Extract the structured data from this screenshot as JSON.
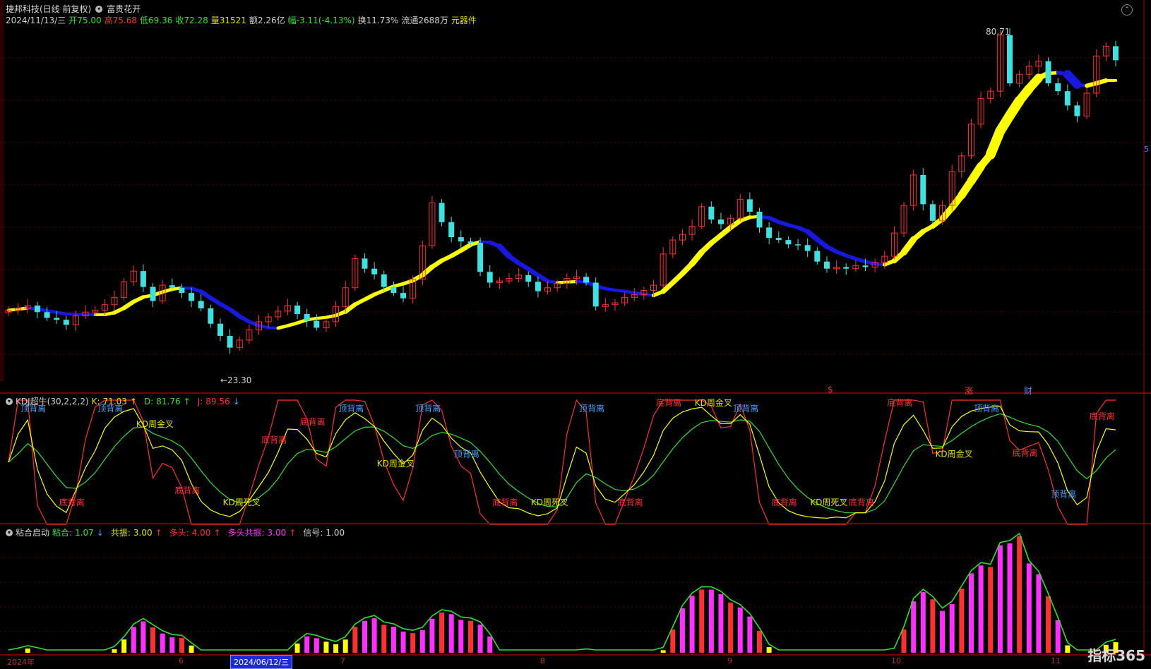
{
  "header": {
    "stock_name": "捷邦科技(日线 前复权)",
    "indicator_name": "富贵花开",
    "date": "2024/11/13/三",
    "open_label": "开",
    "open": "75.00",
    "high_label": "高",
    "high": "75.68",
    "low_label": "低",
    "low": "69.36",
    "close_label": "收",
    "close": "72.28",
    "volume_label": "量",
    "volume": "31521",
    "amount_label": "额",
    "amount": "2.26亿",
    "change_label": "幅",
    "change": "-3.11(-4.13%)",
    "turnover_label": "换",
    "turnover": "11.73%",
    "float_label": "流通",
    "float": "2688万",
    "sector": "元器件"
  },
  "price_chart": {
    "high_marker": "80.71",
    "low_marker": "←23.30",
    "right_edge_label": "5",
    "event_labels": [
      "$",
      "涨",
      "财"
    ]
  },
  "kdj_panel": {
    "title": "KDJ超牛(30,2,2,2)",
    "k_label": "K:",
    "k": "71.03",
    "d_label": "D:",
    "d": "81.76",
    "j_label": "J:",
    "j": "89.56",
    "arrow_up": "↑",
    "arrow_down": "↓",
    "annotations": [
      "顶背离",
      "底背离",
      "顶背离",
      "KD周金叉",
      "底背离",
      "KD周死叉",
      "底背离",
      "底背离",
      "顶背离",
      "KD周金叉",
      "顶背离",
      "顶背离",
      "底背离",
      "KD周死叉",
      "顶背离",
      "底背离",
      "底背离",
      "KD周金叉",
      "顶背离",
      "底背离",
      "KD周死叉",
      "底背离",
      "底背离",
      "KD周金叉",
      "顶背离",
      "底背离",
      "顶背离",
      "底背离"
    ]
  },
  "sticky_panel": {
    "title": "粘合启动",
    "nianhe_label": "粘合:",
    "nianhe": "1.07",
    "gongzhen_label": "共振:",
    "gongzhen": "3.00",
    "duotou_label": "多头:",
    "duotou": "4.00",
    "duotou_gz_label": "多头共振:",
    "duotou_gz": "3.00",
    "signal_label": "信号:",
    "signal": "1.00"
  },
  "x_axis": {
    "labels": [
      "2024年",
      "6",
      "7",
      "8",
      "9",
      "10",
      "11"
    ],
    "cursor_date": "2024/06/12/三"
  },
  "branding": {
    "logo_text": "指标365"
  },
  "colors": {
    "background": "#000000",
    "up": "#ff3030",
    "down": "#40e0e0",
    "ma_up": "#ffff00",
    "ma_down": "#1818e0",
    "green": "#30e030",
    "magenta": "#ff30ff"
  },
  "chart_data": [
    {
      "type": "candlestick",
      "title": "捷邦科技",
      "ohlc_close_approx": [
        27.0,
        27.2,
        27.5,
        26.8,
        26.2,
        26.0,
        25.5,
        26.4,
        26.8,
        27.0,
        27.6,
        28.4,
        30.2,
        31.5,
        29.6,
        28.0,
        29.8,
        29.5,
        28.9,
        28.0,
        27.2,
        25.6,
        24.4,
        23.3,
        24.0,
        25.0,
        25.8,
        26.3,
        26.9,
        27.5,
        26.6,
        25.9,
        25.2,
        25.8,
        27.4,
        29.5,
        33.1,
        31.8,
        31.1,
        29.6,
        28.9,
        28.3,
        30.5,
        34.8,
        41.2,
        38.2,
        36.0,
        35.4,
        35.2,
        31.4,
        30.1,
        30.3,
        30.6,
        31.0,
        30.2,
        29.1,
        29.5,
        30.0,
        30.6,
        30.8,
        30.1,
        27.4,
        27.6,
        27.8,
        28.4,
        28.7,
        29.2,
        29.8,
        33.7,
        35.6,
        36.4,
        37.6,
        40.6,
        38.6,
        37.9,
        38.8,
        41.8,
        39.8,
        37.4,
        35.9,
        35.6,
        35.0,
        34.9,
        34.1,
        32.7,
        31.8,
        32.0,
        31.8,
        32.2,
        32.0,
        32.6,
        33.4,
        36.6,
        40.8,
        46.0,
        41.0,
        38.4,
        40.8,
        46.6,
        49.6,
        56.2,
        62.2,
        64.0,
        79.8,
        66.0,
        68.4,
        70.6,
        72.0,
        66.0,
        64.0,
        60.5,
        58.0,
        63.5,
        73.5,
        76.4,
        72.28
      ],
      "high_label": 80.71,
      "low_label": 23.3
    },
    {
      "type": "line",
      "title": "KDJ超牛(30,2,2,2)",
      "series": [
        {
          "name": "K",
          "last": 71.03
        },
        {
          "name": "D",
          "last": 81.76
        },
        {
          "name": "J",
          "last": 89.56
        }
      ]
    },
    {
      "type": "bar",
      "title": "粘合启动",
      "series": [
        {
          "name": "粘合",
          "last": 1.07
        },
        {
          "name": "共振",
          "last": 3.0
        },
        {
          "name": "多头",
          "last": 4.0
        },
        {
          "name": "多头共振",
          "last": 3.0
        },
        {
          "name": "信号",
          "last": 1.0
        }
      ]
    }
  ]
}
